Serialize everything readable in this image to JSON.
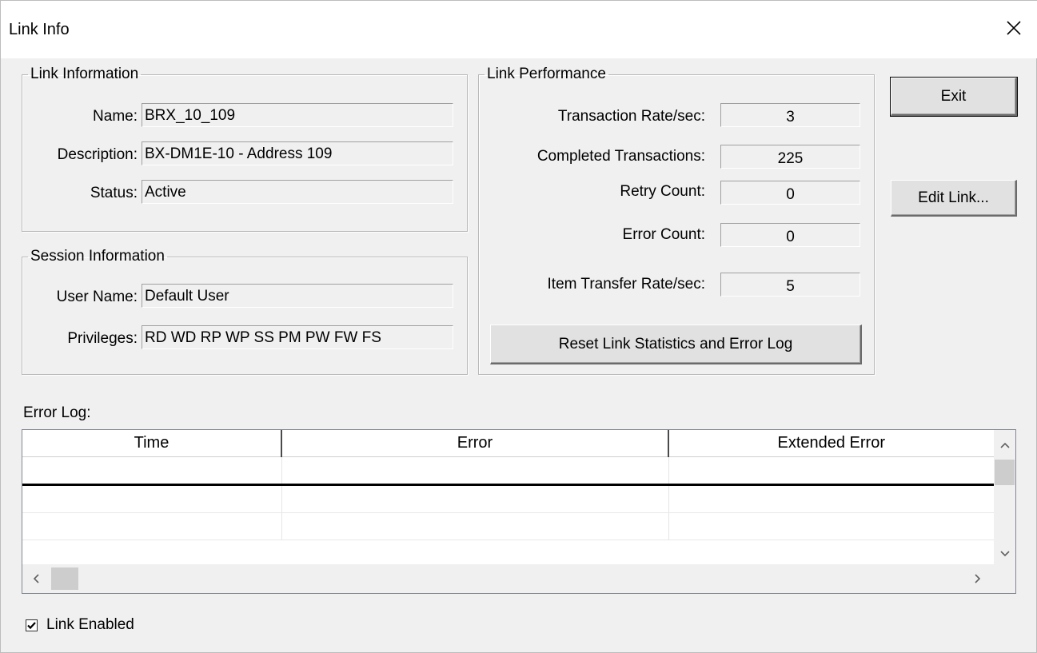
{
  "window": {
    "title": "Link Info"
  },
  "link_information": {
    "legend": "Link Information",
    "name_label": "Name:",
    "name_value": "BRX_10_109",
    "description_label": "Description:",
    "description_value": "BX-DM1E-10 - Address 109",
    "status_label": "Status:",
    "status_value": "Active"
  },
  "session_information": {
    "legend": "Session Information",
    "user_name_label": "User Name:",
    "user_name_value": "Default User",
    "privileges_label": "Privileges:",
    "privileges_value": "RD WD RP WP SS PM PW FW FS"
  },
  "link_performance": {
    "legend": "Link Performance",
    "transaction_rate_label": "Transaction Rate/sec:",
    "transaction_rate_value": "3",
    "completed_transactions_label": "Completed Transactions:",
    "completed_transactions_value": "225",
    "retry_count_label": "Retry Count:",
    "retry_count_value": "0",
    "error_count_label": "Error Count:",
    "error_count_value": "0",
    "item_transfer_rate_label": "Item Transfer Rate/sec:",
    "item_transfer_rate_value": "5",
    "reset_button": "Reset Link Statistics and Error Log"
  },
  "buttons": {
    "exit": "Exit",
    "edit_link": "Edit Link..."
  },
  "error_log": {
    "label": "Error Log:",
    "columns": [
      "Time",
      "Error",
      "Extended Error"
    ]
  },
  "link_enabled": {
    "label": "Link Enabled",
    "checked": true
  }
}
